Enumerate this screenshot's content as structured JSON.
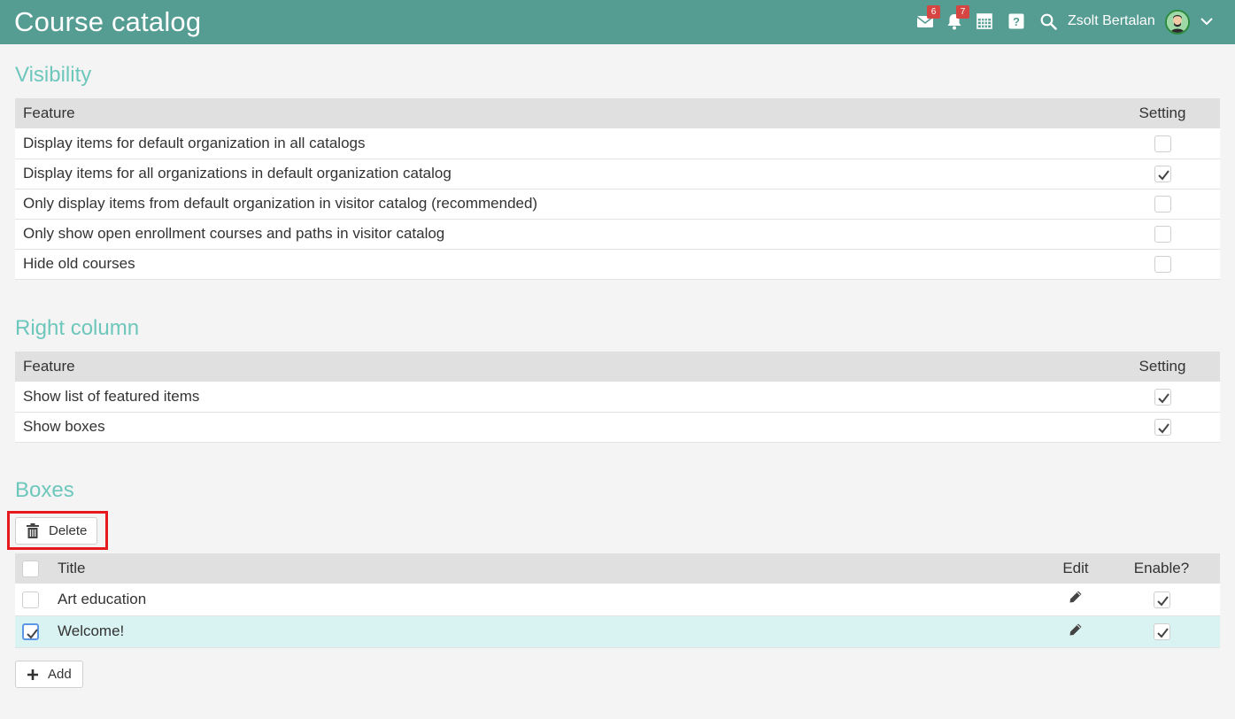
{
  "header": {
    "title": "Course catalog",
    "messages_badge": "6",
    "notifications_badge": "7",
    "user_name": "Zsolt Bertalan",
    "bar_color": "#559c92"
  },
  "visibility": {
    "title": "Visibility",
    "col_feature": "Feature",
    "col_setting": "Setting",
    "rows": [
      {
        "label": "Display items for default organization in all catalogs",
        "checked": false
      },
      {
        "label": "Display items for all organizations in default organization catalog",
        "checked": true
      },
      {
        "label": "Only display items from default organization in visitor catalog (recommended)",
        "checked": false
      },
      {
        "label": "Only show open enrollment courses and paths in visitor catalog",
        "checked": false
      },
      {
        "label": "Hide old courses",
        "checked": false
      }
    ]
  },
  "right_column": {
    "title": "Right column",
    "col_feature": "Feature",
    "col_setting": "Setting",
    "rows": [
      {
        "label": "Show list of featured items",
        "checked": true
      },
      {
        "label": "Show boxes",
        "checked": true
      }
    ]
  },
  "boxes": {
    "title": "Boxes",
    "delete_label": "Delete",
    "add_label": "Add",
    "col_title": "Title",
    "col_edit": "Edit",
    "col_enable": "Enable?",
    "rows": [
      {
        "title": "Art education",
        "selected": false,
        "enabled": true
      },
      {
        "title": "Welcome!",
        "selected": true,
        "enabled": true
      }
    ]
  }
}
